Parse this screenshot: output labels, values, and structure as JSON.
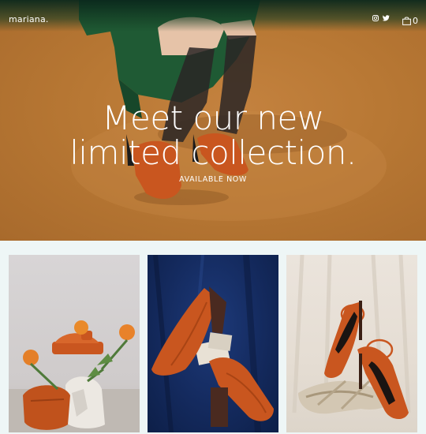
{
  "header": {
    "brand": "mariana.",
    "cart_count": "0",
    "icons": [
      "instagram-icon",
      "twitter-icon",
      "shopping-bag-icon"
    ]
  },
  "hero": {
    "headline_line1": "Meet our new",
    "headline_line2": "limited collection.",
    "cta": "AVAILABLE NOW"
  },
  "products": [
    {
      "name": "orange platform sandal with flowers"
    },
    {
      "name": "orange pointed pumps on blue velvet"
    },
    {
      "name": "orange ankle-strap heels on cream drape"
    }
  ],
  "colors": {
    "hero_background": "#b87834",
    "accent_orange": "#c9561f",
    "page_background": "#eef6f6",
    "dress_green": "#1f5a34"
  }
}
